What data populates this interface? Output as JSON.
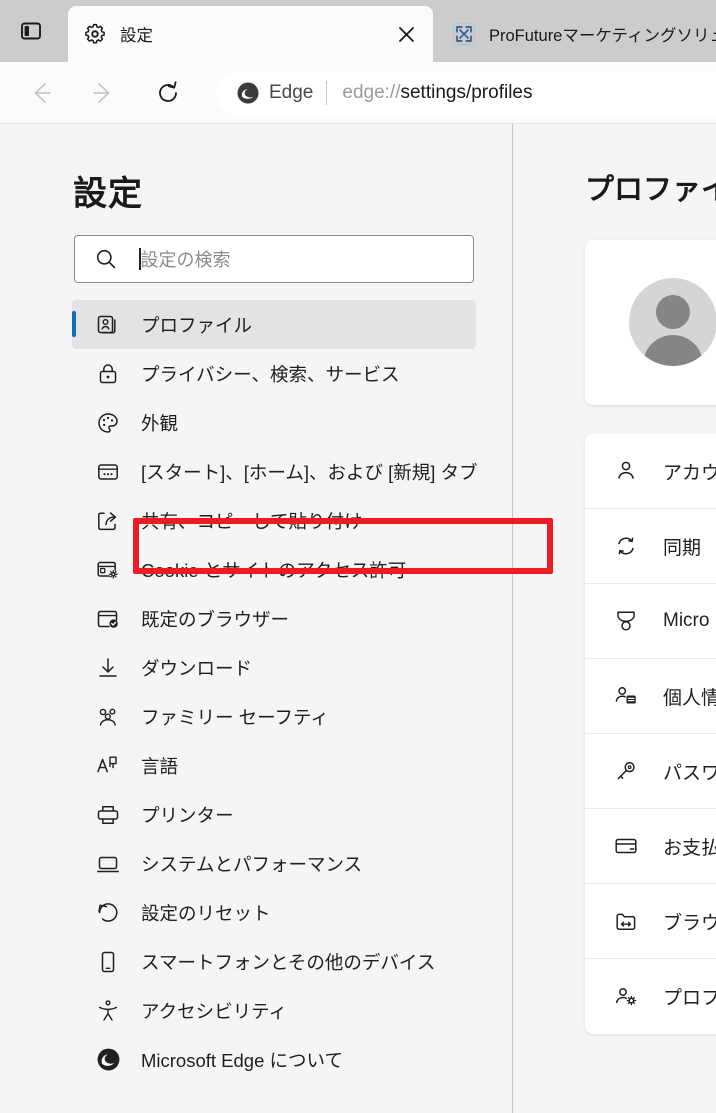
{
  "window": {
    "tab_actions_icon": "vertical-tabs-icon",
    "tabs": [
      {
        "title": "設定",
        "favicon": "gear-icon",
        "active": true,
        "close_label": "×"
      },
      {
        "title": "ProFutureマーケティングソリューシ",
        "favicon": "broken-image-icon",
        "active": false
      }
    ]
  },
  "toolbar": {
    "back_icon": "arrow-left-icon",
    "forward_icon": "arrow-right-icon",
    "reload_icon": "reload-icon",
    "omnibox": {
      "brand": "Edge",
      "url_prefix": "edge://",
      "url_strong": "settings/profiles",
      "edge_icon": "edge-logo-icon"
    }
  },
  "sidebar": {
    "title": "設定",
    "search": {
      "placeholder": "設定の検索",
      "value": "",
      "icon": "search-icon"
    },
    "items": [
      {
        "label": "プロファイル",
        "icon": "profile-icon",
        "selected": true
      },
      {
        "label": "プライバシー、検索、サービス",
        "icon": "lock-icon",
        "selected": false
      },
      {
        "label": "外観",
        "icon": "palette-icon",
        "selected": false
      },
      {
        "label": "[スタート]、[ホーム]、および [新規] タブ",
        "icon": "new-tab-icon",
        "selected": false
      },
      {
        "label": "共有、コピーして貼り付け",
        "icon": "share-icon",
        "selected": false
      },
      {
        "label": "Cookie とサイトのアクセス許可",
        "icon": "cookie-permissions-icon",
        "selected": false
      },
      {
        "label": "既定のブラウザー",
        "icon": "default-browser-icon",
        "selected": false
      },
      {
        "label": "ダウンロード",
        "icon": "download-icon",
        "selected": false
      },
      {
        "label": "ファミリー セーフティ",
        "icon": "family-safety-icon",
        "selected": false
      },
      {
        "label": "言語",
        "icon": "language-icon",
        "selected": false
      },
      {
        "label": "プリンター",
        "icon": "printer-icon",
        "selected": false
      },
      {
        "label": "システムとパフォーマンス",
        "icon": "system-performance-icon",
        "selected": false
      },
      {
        "label": "設定のリセット",
        "icon": "reset-icon",
        "selected": false
      },
      {
        "label": "スマートフォンとその他のデバイス",
        "icon": "phone-icon",
        "selected": false
      },
      {
        "label": "アクセシビリティ",
        "icon": "accessibility-icon",
        "selected": false
      },
      {
        "label": "Microsoft Edge について",
        "icon": "edge-logo-icon",
        "selected": false
      }
    ]
  },
  "annotation": {
    "type": "red-highlight-rectangle",
    "target_label": "プライバシー、検索、サービス",
    "color": "#ed1c24"
  },
  "content": {
    "title": "プロファイル",
    "avatar": "default-avatar-icon",
    "rows": [
      {
        "label": "アカウ",
        "icon": "person-icon"
      },
      {
        "label": "同期",
        "icon": "sync-icon"
      },
      {
        "label": "Micro",
        "icon": "rewards-icon"
      },
      {
        "label": "個人情",
        "icon": "personal-info-icon"
      },
      {
        "label": "パスワ",
        "icon": "key-icon"
      },
      {
        "label": "お支払",
        "icon": "credit-card-icon"
      },
      {
        "label": "ブラウザ",
        "icon": "import-browser-data-icon"
      },
      {
        "label": "プロフ",
        "icon": "profile-preferences-icon"
      }
    ]
  }
}
